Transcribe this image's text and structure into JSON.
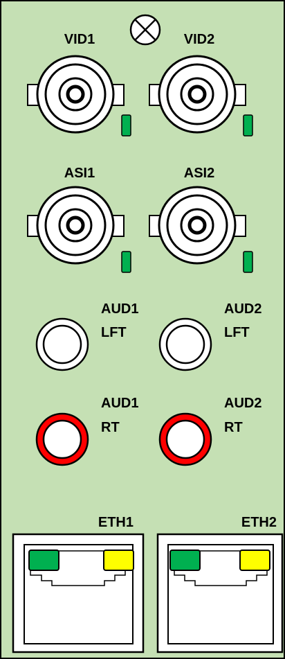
{
  "panel": {
    "background_color": "#c5e0b4",
    "border_color": "#000000"
  },
  "indicator": {
    "icon": "cross-circle-indicator"
  },
  "bnc": {
    "vid1": {
      "label": "VID1"
    },
    "vid2": {
      "label": "VID2"
    },
    "asi1": {
      "label": "ASI1"
    },
    "asi2": {
      "label": "ASI2"
    }
  },
  "audio": {
    "aud1_lft": {
      "label_line1": "AUD1",
      "label_line2": "LFT",
      "ring_color": "#ffffff"
    },
    "aud2_lft": {
      "label_line1": "AUD2",
      "label_line2": "LFT",
      "ring_color": "#ffffff"
    },
    "aud1_rt": {
      "label_line1": "AUD1",
      "label_line2": "RT",
      "ring_color": "#ff0000"
    },
    "aud2_rt": {
      "label_line1": "AUD2",
      "label_line2": "RT",
      "ring_color": "#ff0000"
    }
  },
  "ethernet": {
    "eth1": {
      "label": "ETH1",
      "link_led_color": "#00b050",
      "activity_led_color": "#ffff00"
    },
    "eth2": {
      "label": "ETH2",
      "link_led_color": "#00b050",
      "activity_led_color": "#ffff00"
    }
  },
  "status_led_color": "#00b050"
}
